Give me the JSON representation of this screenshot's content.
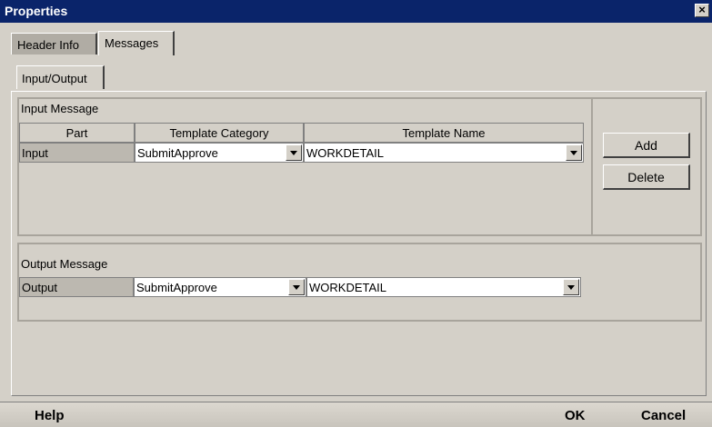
{
  "window": {
    "title": "Properties",
    "close_glyph": "×"
  },
  "tabs": [
    {
      "label": "Header Info",
      "active": false
    },
    {
      "label": "Messages",
      "active": true
    }
  ],
  "subtab": {
    "label": "Input/Output"
  },
  "input_message": {
    "title": "Input Message",
    "columns": [
      "Part",
      "Template Category",
      "Template Name"
    ],
    "rows": [
      {
        "part": "Input",
        "category": "SubmitApprove",
        "name": "WORKDETAIL"
      }
    ],
    "add_label": "Add",
    "delete_label": "Delete"
  },
  "output_message": {
    "title": "Output Message",
    "part": "Output",
    "category": "SubmitApprove",
    "name": "WORKDETAIL"
  },
  "footer": {
    "help_label": "Help",
    "ok_label": "OK",
    "cancel_label": "Cancel"
  }
}
